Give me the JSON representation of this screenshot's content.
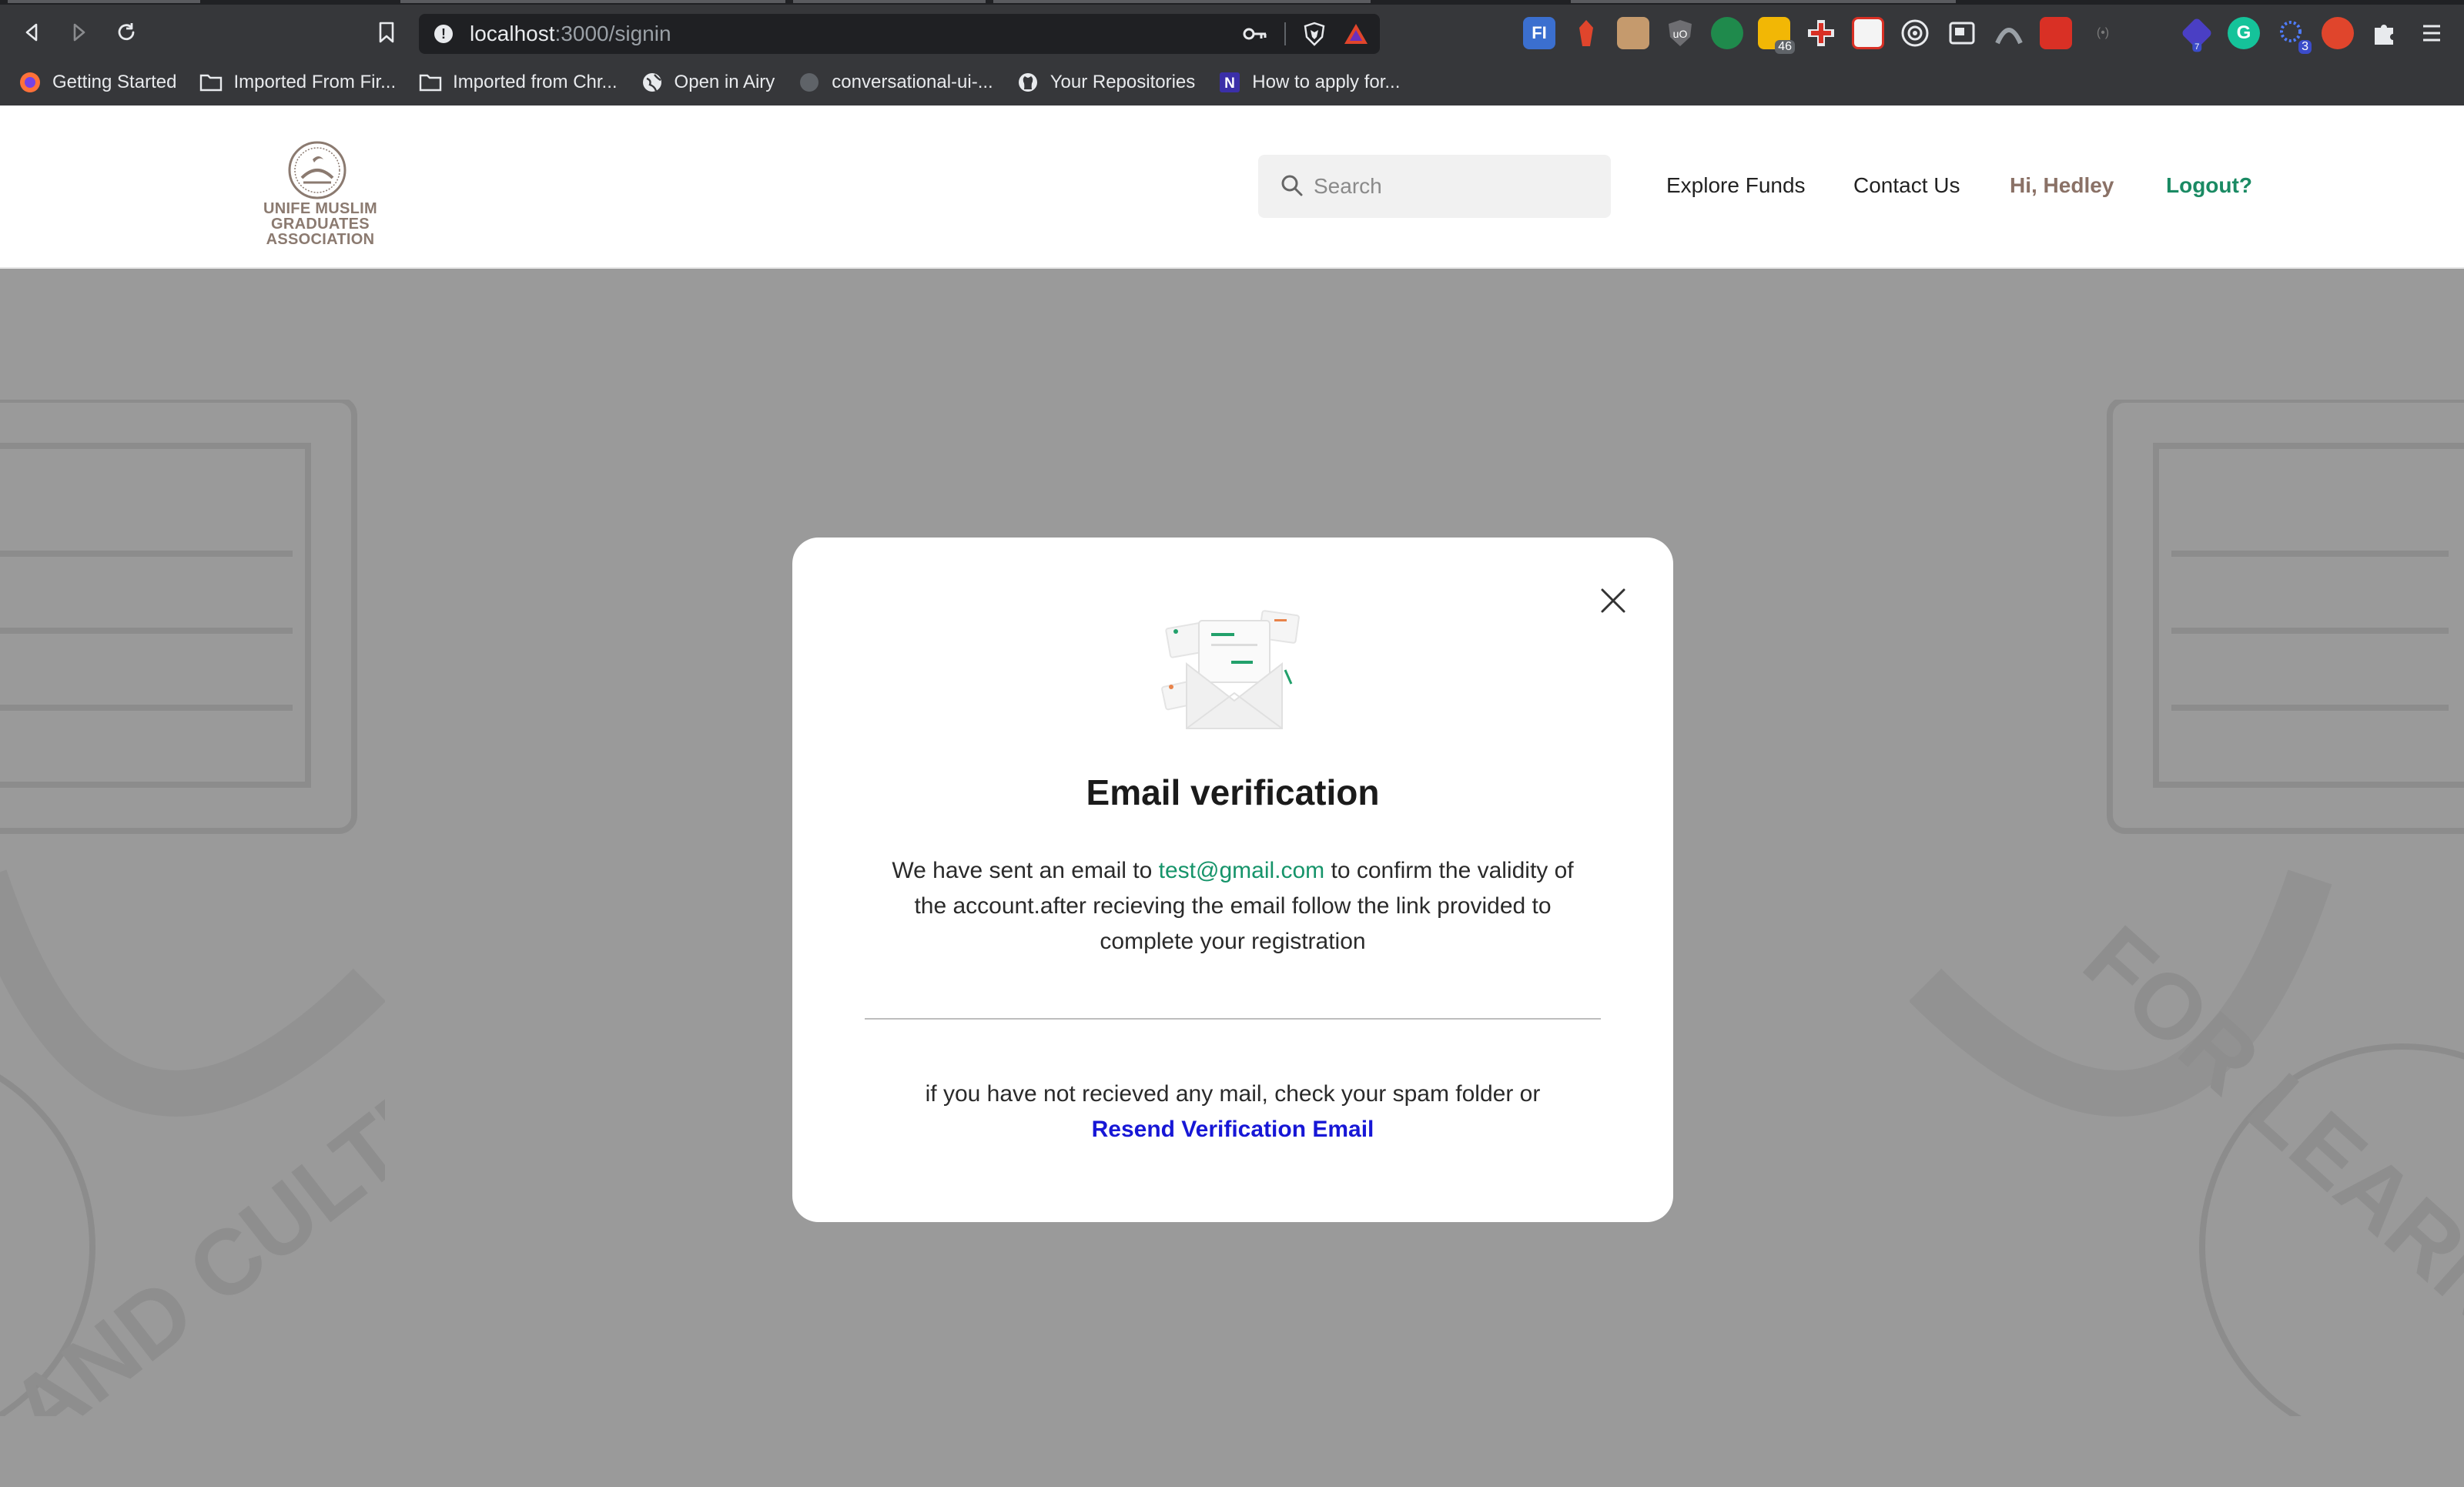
{
  "browser": {
    "url_host": "localhost",
    "url_path": ":3000/signin",
    "extension_badges": {
      "ext5": "46",
      "ext16": "7",
      "ext18": "3"
    },
    "bookmarks": [
      {
        "label": "Getting Started",
        "icon": "firefox-icon"
      },
      {
        "label": "Imported From Fir...",
        "icon": "folder-icon"
      },
      {
        "label": "Imported from Chr...",
        "icon": "folder-icon"
      },
      {
        "label": "Open in Airy",
        "icon": "globe-icon"
      },
      {
        "label": "conversational-ui-...",
        "icon": "github-icon"
      },
      {
        "label": "Your Repositories",
        "icon": "github-icon"
      },
      {
        "label": "How to apply for...",
        "icon": "notion-icon"
      }
    ]
  },
  "header": {
    "logo_line1": "UNIFE MUSLIM GRADUATES",
    "logo_line2": "ASSOCIATION",
    "search_placeholder": "Search",
    "nav": {
      "explore": "Explore Funds",
      "contact": "Contact Us",
      "greeting": "Hi, Hedley",
      "logout": "Logout?"
    }
  },
  "background": {
    "watermark_left": "AND CULTURE",
    "watermark_right": "FOR LEARNING"
  },
  "modal": {
    "title": "Email verification",
    "body_before": "We have sent an email to ",
    "email": "test@gmail.com",
    "body_after": " to confirm the validity of the account.after recieving the email follow the link provided to complete your registration",
    "footer_text": "if you have not recieved any mail, check your spam folder or",
    "resend_label": "Resend Verification Email"
  },
  "colors": {
    "accent_green": "#1a8a63",
    "link_blue": "#1717d6",
    "brand_brown": "#8a7166"
  }
}
